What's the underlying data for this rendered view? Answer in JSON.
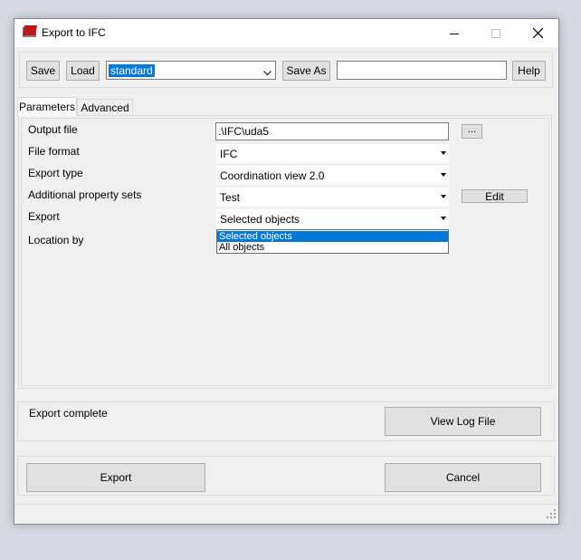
{
  "window": {
    "title": "Export to IFC"
  },
  "toolbar": {
    "save_label": "Save",
    "load_label": "Load",
    "preset_value": "standard",
    "save_as_label": "Save As",
    "save_as_name_value": "",
    "help_label": "Help"
  },
  "tabs": [
    {
      "label": "Parameters",
      "active": true
    },
    {
      "label": "Advanced",
      "active": false
    }
  ],
  "parameters": {
    "output_file_label": "Output file",
    "output_file_value": ".\\IFC\\uda5",
    "browse_label": "...",
    "file_format_label": "File format",
    "file_format_value": "IFC",
    "export_type_label": "Export type",
    "export_type_value": "Coordination view 2.0",
    "additional_psets_label": "Additional property sets",
    "additional_psets_value": "Test",
    "edit_label": "Edit",
    "export_label": "Export",
    "export_value": "Selected objects",
    "location_by_label": "Location by"
  },
  "export_dropdown": {
    "options": [
      "Selected objects",
      "All objects"
    ],
    "selected": "Selected objects"
  },
  "status": {
    "message": "Export complete",
    "view_log_label": "View Log File"
  },
  "footer": {
    "export_button_label": "Export",
    "cancel_button_label": "Cancel"
  },
  "colors": {
    "accent_selection": "#0078d7",
    "app_icon": "#c0161c"
  }
}
